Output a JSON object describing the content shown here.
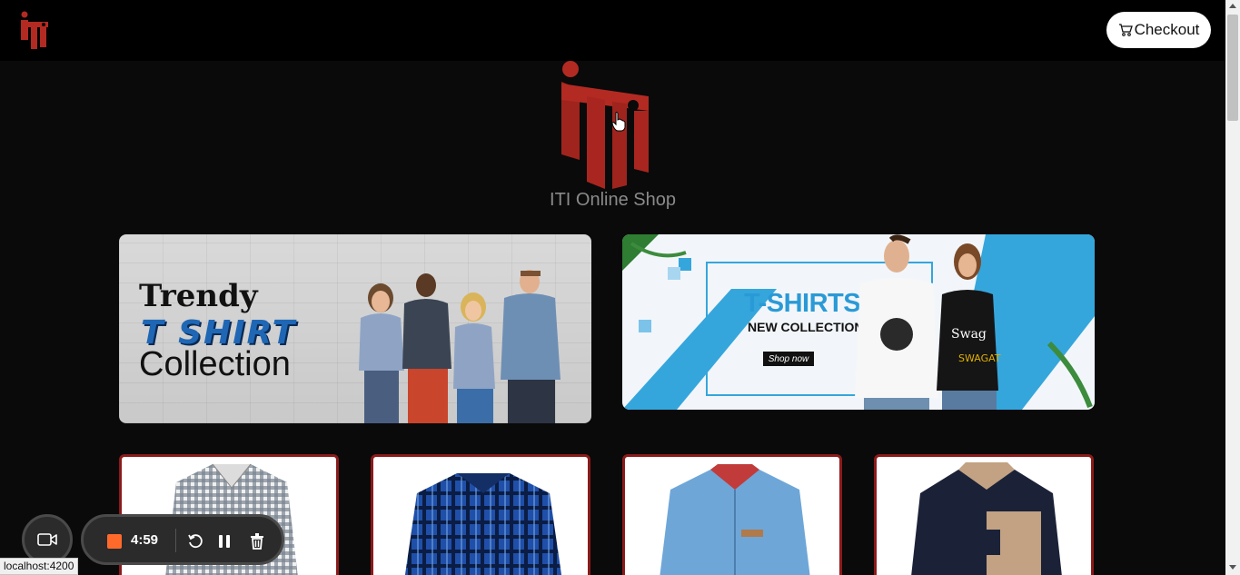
{
  "navbar": {
    "logo_icon": "iti-logo-icon",
    "checkout_label": "Checkout",
    "cart_icon": "cart-icon"
  },
  "hero": {
    "logo_icon": "iti-logo-icon",
    "shop_name": "ITI Online Shop"
  },
  "banners": [
    {
      "title_line1": "Trendy",
      "title_line2": "T SHIRT",
      "title_line3": "Collection"
    },
    {
      "title": "T-SHIRTS",
      "subtitle": "NEW COLLECTION",
      "button_label": "Shop now"
    }
  ],
  "products": [
    {
      "image_icon": "gingham-shirt-image"
    },
    {
      "image_icon": "blue-plaid-shirt-image"
    },
    {
      "image_icon": "denim-shirt-image"
    },
    {
      "image_icon": "navy-khaki-shirt-image"
    }
  ],
  "recorder": {
    "camera_icon": "video-camera-icon",
    "timer": "4:59",
    "stop_icon": "stop-icon",
    "restart_icon": "restart-icon",
    "pause_icon": "pause-icon",
    "delete_icon": "trash-icon"
  },
  "status_bar": {
    "url": "localhost:4200"
  },
  "colors": {
    "brand_red": "#b32a22",
    "background": "#0a0a0a",
    "record_orange": "#ff6a2b",
    "card_border": "#8b1a1a"
  }
}
